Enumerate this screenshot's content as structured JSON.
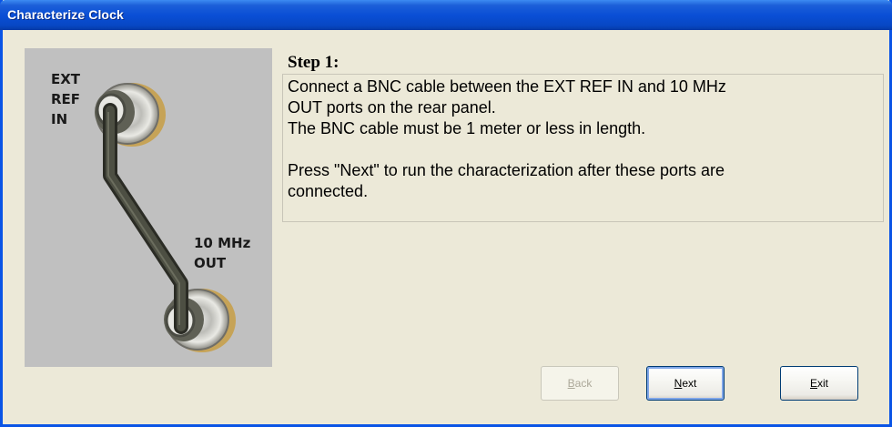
{
  "window": {
    "title": "Characterize Clock"
  },
  "illustration": {
    "ext_ref_label": [
      "EXT",
      "REF",
      "IN"
    ],
    "out_label": [
      "10 MHz",
      "OUT"
    ]
  },
  "step": {
    "heading": "Step 1:",
    "lines": [
      "Connect a BNC cable between the EXT REF IN and 10 MHz",
      "OUT ports on the rear panel.",
      "The BNC cable must be 1 meter or less in length.",
      "",
      "Press \"Next\" to run the characterization after these ports are",
      "connected."
    ]
  },
  "buttons": {
    "back": {
      "first": "B",
      "rest": "ack",
      "enabled": false
    },
    "next": {
      "first": "N",
      "rest": "ext",
      "enabled": true
    },
    "exit": {
      "first": "E",
      "rest": "xit",
      "enabled": true
    }
  },
  "colors": {
    "titlebar": "#0a4fd6",
    "dialog_bg": "#ece9d8",
    "illustration_bg": "#c0c0c0",
    "cable": "#3d3f35"
  }
}
